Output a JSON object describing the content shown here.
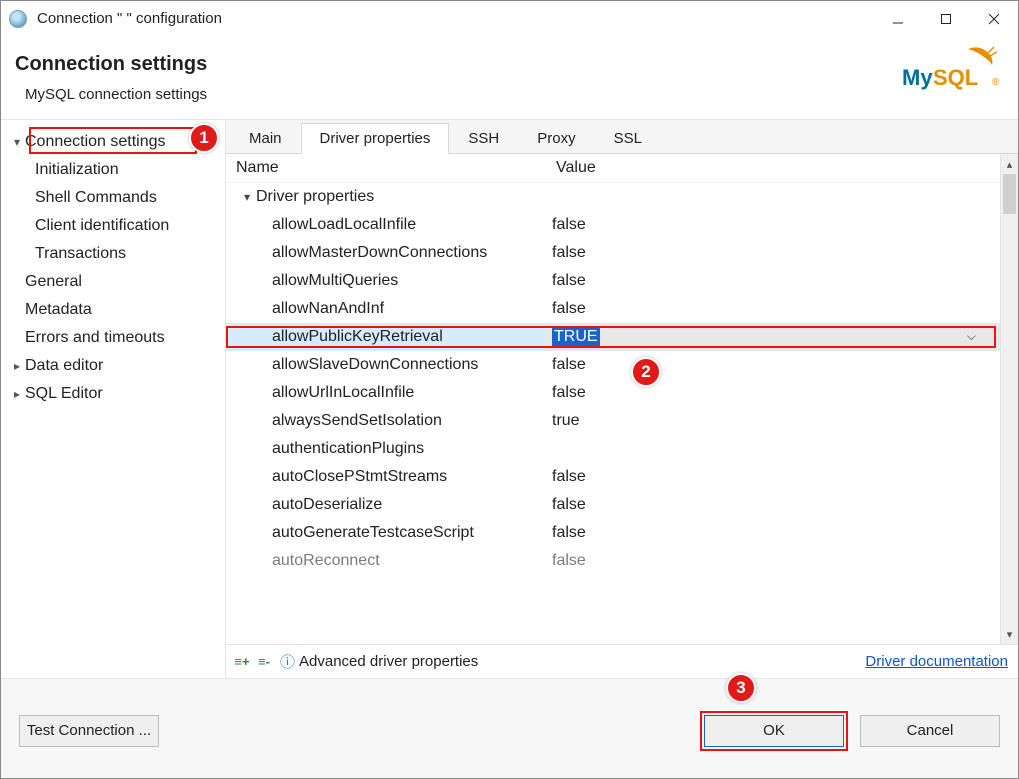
{
  "window": {
    "title": "Connection \"               \" configuration"
  },
  "heading": {
    "title": "Connection settings",
    "subtitle": "MySQL connection settings",
    "logo_text": "MySQL"
  },
  "tree": {
    "items": [
      {
        "label": "Connection settings",
        "level": 0,
        "expanded": true,
        "selected": true
      },
      {
        "label": "Initialization",
        "level": 1
      },
      {
        "label": "Shell Commands",
        "level": 1
      },
      {
        "label": "Client identification",
        "level": 1
      },
      {
        "label": "Transactions",
        "level": 1
      },
      {
        "label": "General",
        "level": 0
      },
      {
        "label": "Metadata",
        "level": 0
      },
      {
        "label": "Errors and timeouts",
        "level": 0
      },
      {
        "label": "Data editor",
        "level": 0,
        "expandable": true
      },
      {
        "label": "SQL Editor",
        "level": 0,
        "expandable": true
      }
    ]
  },
  "tabs": [
    {
      "label": "Main"
    },
    {
      "label": "Driver properties",
      "active": true
    },
    {
      "label": "SSH"
    },
    {
      "label": "Proxy"
    },
    {
      "label": "SSL"
    }
  ],
  "grid": {
    "columns": {
      "name": "Name",
      "value": "Value"
    },
    "group_label": "Driver properties",
    "rows": [
      {
        "name": "allowLoadLocalInfile",
        "value": "false"
      },
      {
        "name": "allowMasterDownConnections",
        "value": "false"
      },
      {
        "name": "allowMultiQueries",
        "value": "false"
      },
      {
        "name": "allowNanAndInf",
        "value": "false"
      },
      {
        "name": "allowPublicKeyRetrieval",
        "value": "TRUE",
        "highlighted": true
      },
      {
        "name": "allowSlaveDownConnections",
        "value": "false"
      },
      {
        "name": "allowUrlInLocalInfile",
        "value": "false"
      },
      {
        "name": "alwaysSendSetIsolation",
        "value": "true"
      },
      {
        "name": "authenticationPlugins",
        "value": ""
      },
      {
        "name": "autoClosePStmtStreams",
        "value": "false"
      },
      {
        "name": "autoDeserialize",
        "value": "false"
      },
      {
        "name": "autoGenerateTestcaseScript",
        "value": "false"
      },
      {
        "name": "autoReconnect",
        "value": "false"
      }
    ]
  },
  "advbar": {
    "label": "Advanced driver properties",
    "link": "Driver documentation"
  },
  "footer": {
    "test": "Test Connection ...",
    "ok": "OK",
    "cancel": "Cancel"
  },
  "annotations": {
    "b1": "1",
    "b2": "2",
    "b3": "3"
  }
}
